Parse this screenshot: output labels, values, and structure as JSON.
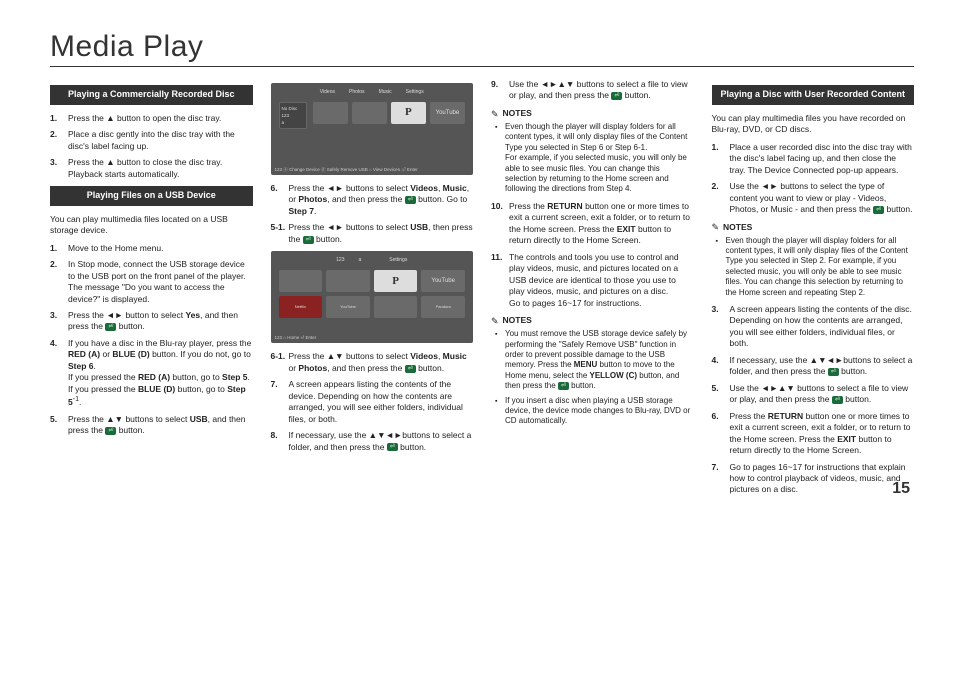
{
  "title": "Media Play",
  "pageNumber": "15",
  "col1": {
    "header1": "Playing a Commercially Recorded Disc",
    "steps1": [
      {
        "n": "1.",
        "t": "Press the ▲ button to open the disc tray."
      },
      {
        "n": "2.",
        "t": "Place a disc gently into the disc tray with the disc's label facing up."
      },
      {
        "n": "3.",
        "t": "Press the ▲ button to close the disc tray. Playback starts automatically."
      }
    ],
    "header2": "Playing Files on a USB Device",
    "intro2": "You can play multimedia files located on a USB storage device.",
    "steps2": [
      {
        "n": "1.",
        "t": "Move to the Home menu."
      },
      {
        "n": "2.",
        "t": "In Stop mode, connect the USB storage device to the USB port on the front panel of the player.\nThe message \"Do you want to access the device?\" is displayed."
      },
      {
        "n": "3.",
        "t": "Press the ◄► button to select <b>Yes</b>, and then press the [C] button."
      },
      {
        "n": "4.",
        "t": "If you have a disc in the Blu-ray player, press the <b>RED (A)</b> or <b>BLUE (D)</b> button. If you do not, go to <b>Step 6</b>.\nIf you pressed the <b>RED (A)</b> button, go to <b>Step 5</b>.\nIf you pressed the <b>BLUE (D)</b> button, go to <b>Step 5</b><sup>-1</sup>."
      },
      {
        "n": "5.",
        "t": "Press the ▲▼ buttons to select <b>USB</b>, and then press the [C] button."
      }
    ]
  },
  "col2": {
    "ss1": {
      "tabs": [
        "Videos",
        "Photos",
        "Music",
        "Settings"
      ],
      "side": [
        "No Disc",
        "123",
        "a"
      ],
      "grid": [
        "",
        "",
        "P",
        "YouTube"
      ],
      "foot": "123   ⓐ Change Device   ⓓ Safely Remove USB   ⌂ View Devices   ⏎ Enter"
    },
    "steps1": [
      {
        "n": "6.",
        "t": "Press the ◄► buttons to select <b>Videos</b>, <b>Music</b>, or <b>Photos</b>, and then press the [C] button. Go to <b>Step 7</b>."
      },
      {
        "n": "5-1.",
        "t": "Press the ◄► buttons to select <b>USB</b>, then press the [C] button."
      }
    ],
    "ss2": {
      "tabs": [
        "123",
        "a",
        "",
        "Settings"
      ],
      "grid": [
        "",
        "",
        "P",
        "YouTube"
      ],
      "foot": "123                                      ⌂ Home   ⏎ Enter",
      "bl": [
        "Netflix",
        "YouTube",
        "",
        "Pandora"
      ]
    },
    "steps2": [
      {
        "n": "6-1.",
        "t": "Press the ▲▼ buttons to select <b>Videos</b>, <b>Music</b> or <b>Photos</b>, and then press the [C] button."
      },
      {
        "n": "7.",
        "t": "A screen appears listing the contents of the device. Depending on how the contents are arranged, you will see either folders, individual files, or both."
      },
      {
        "n": "8.",
        "t": "If necessary, use the ▲▼◄►buttons to select a folder, and then press the [C]  button."
      }
    ]
  },
  "col3": {
    "steps1": [
      {
        "n": "9.",
        "t": "Use the ◄►▲▼ buttons to select a file to view or play, and then press the [C] button."
      }
    ],
    "notesLabel": "NOTES",
    "notes1": [
      "Even though the player will display folders for all content types, it will only display files of the Content Type you selected in Step 6 or Step 6-1.\nFor example, if you selected music, you will only be able to see music files. You can change this selection by returning to the Home screen and following the directions from Step 4."
    ],
    "steps2": [
      {
        "n": "10.",
        "t": "Press the <b>RETURN</b> button one or more times to exit a current screen, exit a folder, or to return to the Home screen. Press the <b>EXIT</b> button to return directly to the Home Screen."
      },
      {
        "n": "11.",
        "t": "The controls and tools you use to control and play videos, music, and pictures located on a USB device are identical to those you use to play videos, music, and pictures on a disc.\nGo to pages 16~17 for instructions."
      }
    ],
    "notes2": [
      "You must remove the USB storage device safely by performing the \"Safely Remove USB\" function in order to prevent possible damage to the USB memory. Press the <b>MENU</b> button to move to the Home menu, select the <b>YELLOW (C)</b> button, and then press the [C] button.",
      "If you insert a disc when playing a USB storage device, the device mode changes to Blu-ray, DVD or CD automatically."
    ]
  },
  "col4": {
    "header": "Playing a Disc with User Recorded Content",
    "intro": "You can play multimedia files you have recorded on Blu-ray, DVD, or CD discs.",
    "steps1": [
      {
        "n": "1.",
        "t": "Place a user recorded disc into the disc tray with the disc's label facing up, and then close the tray. The Device Connected pop-up appears."
      },
      {
        "n": "2.",
        "t": "Use the ◄► buttons to select the type of content you want to view or play - Videos, Photos, or Music - and then press the [C] button."
      }
    ],
    "notesLabel": "NOTES",
    "notes1": [
      "Even though the player will display folders for all content types, it will only display files of the Content Type you selected in Step 2. For example, if you selected music, you will only be able to see music files. You can change this selection by returning to the Home screen and repeating Step 2."
    ],
    "steps2": [
      {
        "n": "3.",
        "t": "A screen appears listing the contents of the disc. Depending on how the contents are arranged, you will see either folders, individual files, or both."
      },
      {
        "n": "4.",
        "t": "If necessary, use the ▲▼◄►buttons to select a folder, and then press the [C] button."
      },
      {
        "n": "5.",
        "t": "Use the ◄►▲▼ buttons to select a file to view or play, and then press the [C] button."
      },
      {
        "n": "6.",
        "t": "Press the <b>RETURN</b> button one or more times to exit a current screen, exit a folder, or to return to the Home screen. Press the <b>EXIT</b> button to return directly to the Home Screen."
      },
      {
        "n": "7.",
        "t": "Go to pages 16~17 for instructions that explain how to control playback of videos, music, and pictures on a disc."
      }
    ]
  }
}
